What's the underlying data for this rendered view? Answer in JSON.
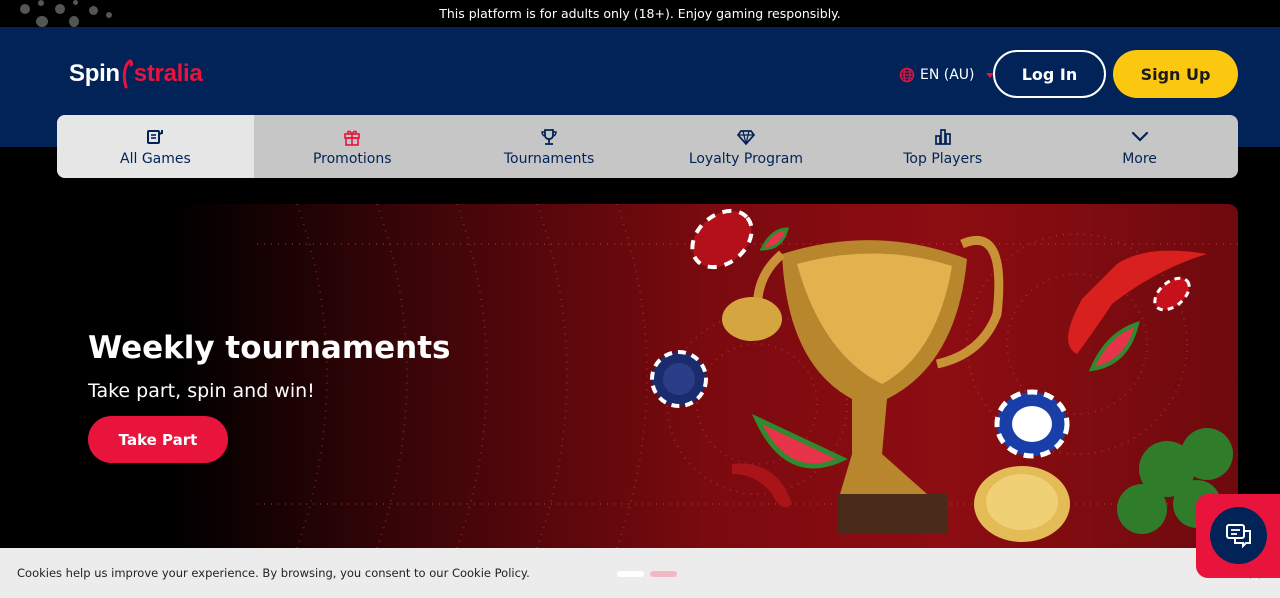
{
  "notice_bar": {
    "text": "This platform is for adults only (18+). Enjoy gaming responsibly."
  },
  "header": {
    "logo": {
      "part1": "Spin",
      "part2": "stralia"
    },
    "language": {
      "label": "EN (AU)",
      "icon": "globe-icon"
    },
    "login_label": "Log In",
    "signup_label": "Sign Up",
    "colors": {
      "background": "#022358",
      "accent": "#e8143c",
      "signup": "#fcc70f"
    }
  },
  "nav": {
    "items": [
      {
        "label": "All Games",
        "icon": "games-icon",
        "active": true
      },
      {
        "label": "Promotions",
        "icon": "gift-icon"
      },
      {
        "label": "Tournaments",
        "icon": "trophy-icon"
      },
      {
        "label": "Loyalty Program",
        "icon": "diamond-icon"
      },
      {
        "label": "Top Players",
        "icon": "bar-chart-icon"
      },
      {
        "label": "More",
        "icon": "chevron-down-icon"
      }
    ]
  },
  "hero": {
    "title": "Weekly tournaments",
    "subtitle": "Take part, spin and win!",
    "cta_label": "Take Part"
  },
  "carousel": {
    "slides": 2,
    "active": 1
  },
  "cookie_banner": {
    "text": "Cookies help us improve your experience. By browsing, you consent to our Cookie Policy."
  }
}
